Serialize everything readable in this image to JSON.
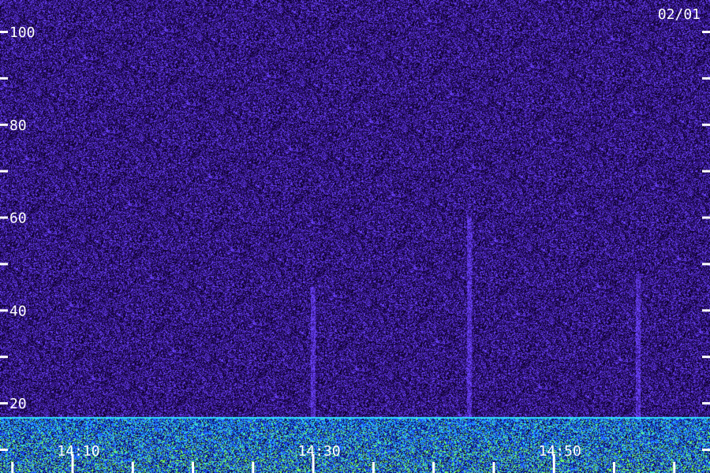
{
  "date_label": "02/01",
  "chart_data": {
    "type": "heatmap",
    "title": "",
    "xlabel": "",
    "ylabel": "",
    "ylim": [
      0,
      100
    ],
    "xlim_minutes": [
      "14:04",
      "15:03"
    ],
    "y_tick_labels": [
      "20",
      "40",
      "60",
      "80",
      "100"
    ],
    "y_tick_values": [
      20,
      40,
      60,
      80,
      100
    ],
    "y_minor_tick_values": [
      10,
      30,
      50,
      70,
      90
    ],
    "x_tick_labels": [
      "14:10",
      "14:30",
      "14:50"
    ],
    "x_tick_times": [
      "14:10",
      "14:30",
      "14:50"
    ],
    "minor_x_tick_times": [
      "14:05",
      "14:15",
      "14:20",
      "14:25",
      "14:35",
      "14:40",
      "14:45",
      "14:55",
      "15:00"
    ],
    "grid": false,
    "legend": "none",
    "colors": {
      "background": "#2a1258",
      "noise_low": "#1a0a3a",
      "noise_high": "#5a30c8",
      "band_blue": "#2060ff",
      "band_cyan": "#30e0ff",
      "band_green": "#80ff60",
      "tick": "#ffffff"
    },
    "features": [
      {
        "kind": "low_frequency_band",
        "y_range": [
          0,
          17
        ]
      },
      {
        "kind": "vertical_streak",
        "time": "14:30",
        "y_range": [
          17,
          45
        ]
      },
      {
        "kind": "vertical_streak",
        "time": "14:43",
        "y_range": [
          17,
          60
        ]
      },
      {
        "kind": "vertical_streak",
        "time": "14:57",
        "y_range": [
          17,
          48
        ]
      }
    ]
  }
}
